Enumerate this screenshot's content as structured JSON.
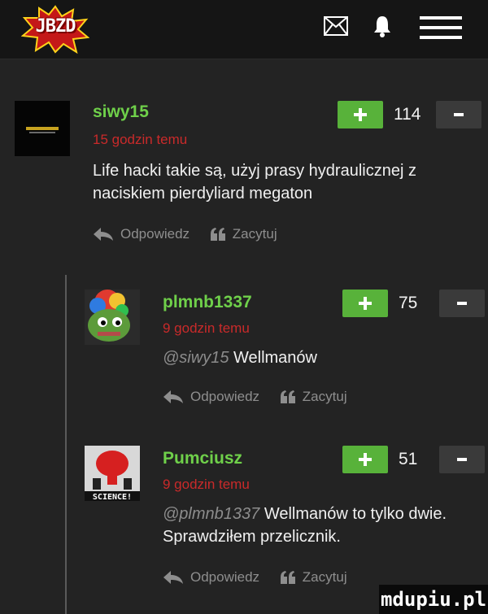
{
  "header": {
    "logo_text": "JBZD",
    "icons": [
      "mail-icon",
      "bell-icon",
      "menu-icon"
    ]
  },
  "comments": [
    {
      "username": "siwy15",
      "time": "15 godzin temu",
      "text": "Life hacki takie są, użyj prasy hydraulicznej z naciskiem pierdyliard megaton",
      "mention": "",
      "votes": "114",
      "reply_label": "Odpowiedz",
      "quote_label": "Zacytuj"
    },
    {
      "username": "plmnb1337",
      "time": "9 godzin temu",
      "mention": "@siwy15",
      "text": "Wellmanów",
      "votes": "75",
      "reply_label": "Odpowiedz",
      "quote_label": "Zacytuj"
    },
    {
      "username": "Pumciusz",
      "time": "9 godzin temu",
      "mention": "@plmnb1337",
      "text": "Wellmanów to tylko dwie. Sprawdziłem przelicznik.",
      "votes": "51",
      "reply_label": "Odpowiedz",
      "quote_label": "Zacytuj",
      "avatar_text": "SCIENCE!"
    }
  ],
  "watermark": "mdupiu.pl",
  "colors": {
    "username": "#6fd04a",
    "time": "#c92a2a",
    "vote_plus": "#58b23a",
    "background": "#232323"
  }
}
